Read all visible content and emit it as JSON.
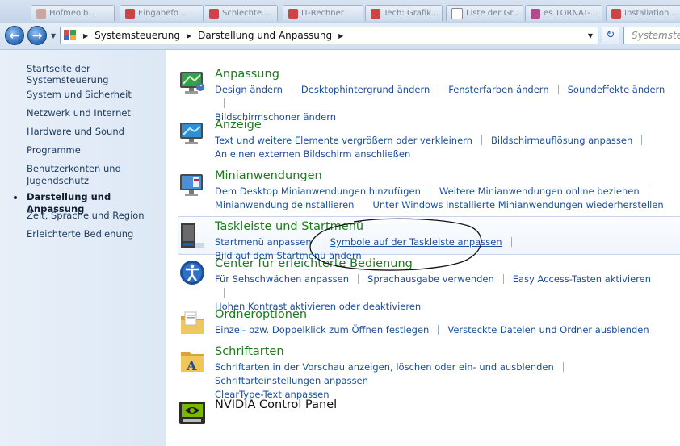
{
  "taskbar": {
    "tabs": [
      "Hofmeolb...",
      "Eingabefo...",
      "Schlechte...",
      "IT-Rechner",
      "Tech: Grafik...",
      "Liste der Gr...",
      "es.TORNAT-...",
      "Installation..."
    ]
  },
  "address_bar": {
    "crumbs": [
      "Systemsteuerung",
      "Darstellung und Anpassung"
    ],
    "search_placeholder": "Systemsteuerung"
  },
  "sidebar": {
    "home": "Startseite der Systemsteuerung",
    "items": [
      {
        "label": "System und Sicherheit"
      },
      {
        "label": "Netzwerk und Internet"
      },
      {
        "label": "Hardware und Sound"
      },
      {
        "label": "Programme"
      },
      {
        "label": "Benutzerkonten und Jugendschutz"
      },
      {
        "label": "Darstellung und Anpassung",
        "active": true
      },
      {
        "label": "Zeit, Sprache und Region"
      },
      {
        "label": "Erleichterte Bedienung"
      }
    ]
  },
  "categories": [
    {
      "title": "Anpassung",
      "icon": "personalization-icon",
      "links": [
        "Design ändern",
        "Desktophintergrund ändern",
        "Fensterfarben ändern",
        "Soundeffekte ändern",
        "Bildschirmschoner ändern"
      ]
    },
    {
      "title": "Anzeige",
      "icon": "display-icon",
      "links": [
        "Text und weitere Elemente vergrößern oder verkleinern",
        "Bildschirmauflösung anpassen",
        "An einen externen Bildschirm anschließen"
      ]
    },
    {
      "title": "Minianwendungen",
      "icon": "gadgets-icon",
      "links": [
        "Dem Desktop Minianwendungen hinzufügen",
        "Weitere Minianwendungen online beziehen",
        "Minianwendung deinstallieren",
        "Unter Windows installierte Minianwendungen wiederherstellen"
      ]
    },
    {
      "title": "Taskleiste und Startmenü",
      "icon": "taskbar-icon",
      "links": [
        "Startmenü anpassen",
        "Symbole auf der Taskleiste anpassen",
        "Bild auf dem Startmenü ändern"
      ]
    },
    {
      "title": "Center für erleichterte Bedienung",
      "icon": "ease-of-access-icon",
      "links": [
        "Für Sehschwächen anpassen",
        "Sprachausgabe verwenden",
        "Easy Access-Tasten aktivieren",
        "Hohen Kontrast aktivieren oder deaktivieren"
      ]
    },
    {
      "title": "Ordneroptionen",
      "icon": "folder-options-icon",
      "links": [
        "Einzel- bzw. Doppelklick zum Öffnen festlegen",
        "Versteckte Dateien und Ordner ausblenden"
      ]
    },
    {
      "title": "Schriftarten",
      "icon": "fonts-icon",
      "links": [
        "Schriftarten in der Vorschau anzeigen, löschen oder ein- und ausblenden",
        "Schriftarteinstellungen anpassen",
        "ClearType-Text anpassen"
      ]
    },
    {
      "title": "NVIDIA Control Panel",
      "icon": "nvidia-icon",
      "links": []
    }
  ],
  "colors": {
    "title_green": "#1e7a1e",
    "link_blue": "#1a4fa0",
    "sidebar_bg": "#e4ecf7"
  }
}
